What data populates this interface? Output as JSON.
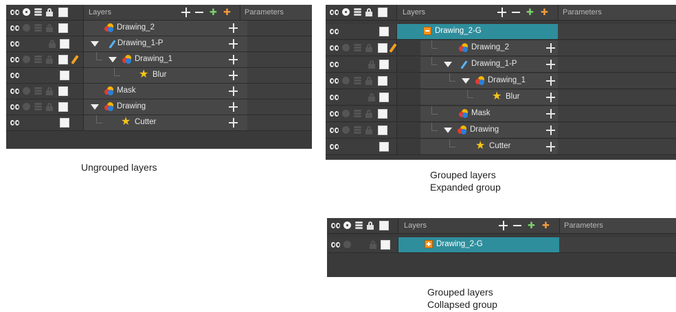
{
  "panels": {
    "ungrouped": {
      "header": {
        "title": "Layers",
        "params": "Parameters"
      },
      "rows": [
        {
          "name": "Drawing_2"
        },
        {
          "name": "Drawing_1-P"
        },
        {
          "name": "Drawing_1"
        },
        {
          "name": "Blur"
        },
        {
          "name": "Mask"
        },
        {
          "name": "Drawing"
        },
        {
          "name": "Cutter"
        }
      ]
    },
    "expanded": {
      "header": {
        "title": "Layers",
        "params": "Parameters"
      },
      "group": "Drawing_2-G",
      "rows": [
        {
          "name": "Drawing_2"
        },
        {
          "name": "Drawing_1-P"
        },
        {
          "name": "Drawing_1"
        },
        {
          "name": "Blur"
        },
        {
          "name": "Mask"
        },
        {
          "name": "Drawing"
        },
        {
          "name": "Cutter"
        }
      ]
    },
    "collapsed": {
      "header": {
        "title": "Layers",
        "params": "Parameters"
      },
      "group": "Drawing_2-G"
    }
  },
  "captions": {
    "ungrouped": "Ungrouped layers",
    "expanded_line1": "Grouped layers",
    "expanded_line2": "Expanded group",
    "collapsed_line1": "Grouped layers",
    "collapsed_line2": "Collapsed group"
  },
  "colors": {
    "group_highlight": "#2e8e9c",
    "panel_bg": "#3a3a3a",
    "star": "#f5c518",
    "group_icon": "#f7931e"
  }
}
